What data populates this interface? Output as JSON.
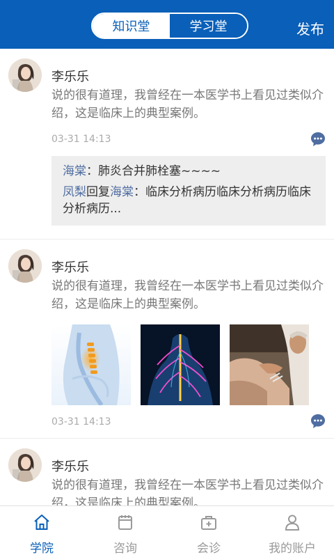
{
  "header": {
    "tabs": [
      {
        "label": "知识堂",
        "active": true
      },
      {
        "label": "学习堂",
        "active": false
      }
    ],
    "publish_label": "发布"
  },
  "posts": [
    {
      "author": "李乐乐",
      "content": "说的很有道理，我曾经在一本医学书上看见过类似介绍，这是临床上的典型案例。",
      "time": "03-31 14:13",
      "comments": [
        {
          "author": "海棠",
          "separator": "：",
          "text": "肺炎合并肺栓塞~~~~"
        },
        {
          "author": "凤梨",
          "reply_word": "回复",
          "reply_to": "海棠",
          "separator": "：",
          "text": "临床分析病历临床分析病历临床分析病历..."
        }
      ]
    },
    {
      "author": "李乐乐",
      "content": "说的很有道理，我曾经在一本医学书上看见过类似介绍，这是临床上的典型案例。",
      "time": "03-31 14:13",
      "images": [
        "spine-image",
        "nerve-image",
        "therapy-image"
      ]
    },
    {
      "author": "李乐乐",
      "content": "说的很有道理，我曾经在一本医学书上看见过类似介绍，这是临床上的典型案例。"
    }
  ],
  "tabbar": [
    {
      "label": "学院",
      "icon": "home-icon",
      "active": true
    },
    {
      "label": "咨询",
      "icon": "calendar-icon",
      "active": false
    },
    {
      "label": "会诊",
      "icon": "medical-kit-icon",
      "active": false
    },
    {
      "label": "我的账户",
      "icon": "person-icon",
      "active": false
    }
  ],
  "colors": {
    "brand": "#0a5fb8",
    "comment_name": "#4f6da1",
    "comment_bg": "#eeeeee",
    "inactive_tab": "#999999"
  }
}
